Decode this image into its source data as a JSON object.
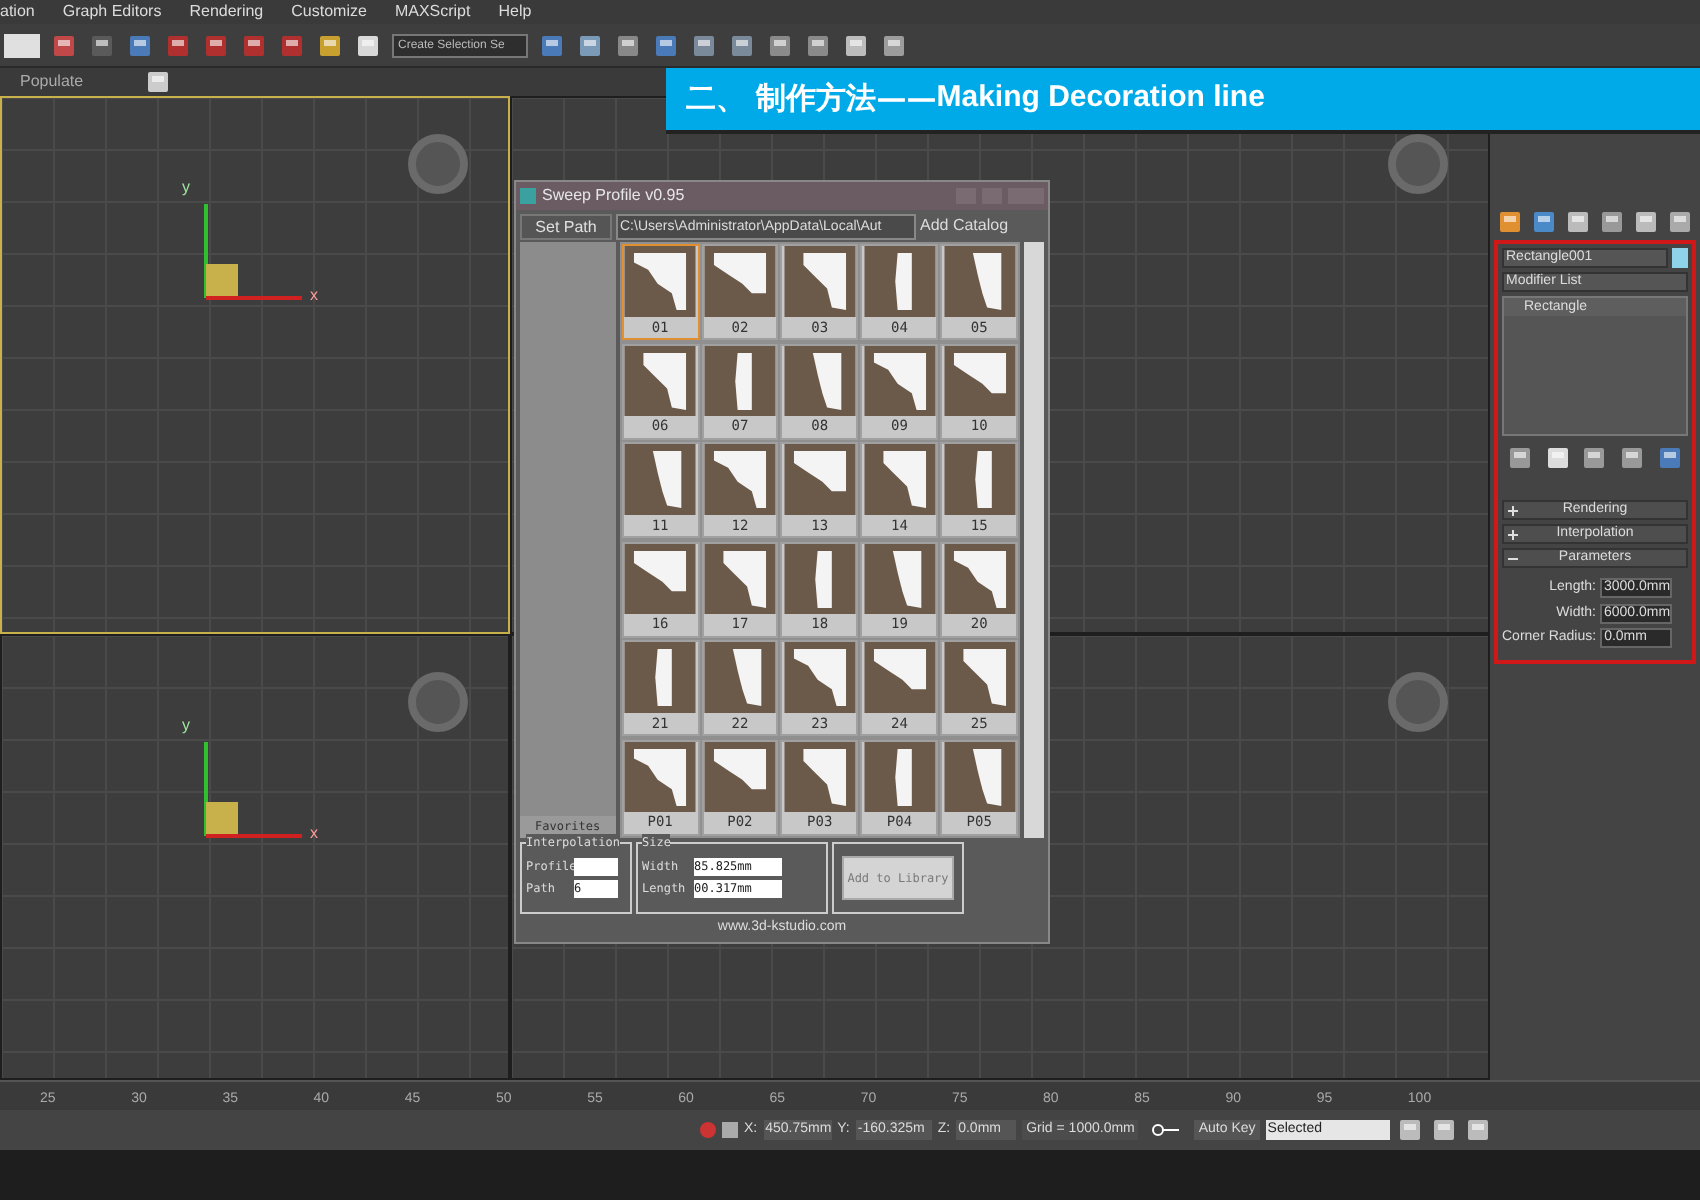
{
  "menu": [
    "ation",
    "Graph Editors",
    "Rendering",
    "Customize",
    "MAXScript",
    "Help"
  ],
  "toolbar": {
    "selection_set": "Create Selection Se"
  },
  "ribbon": {
    "tab": "Populate"
  },
  "banner": {
    "chinese": "二、 制作方法——",
    "english": "Making Decoration line"
  },
  "viewports": [
    {
      "active": true,
      "axis_labels": [
        "y",
        "x"
      ]
    },
    {
      "active": false
    },
    {
      "active": false,
      "axis_labels": [
        "y",
        "x"
      ]
    },
    {
      "active": false
    }
  ],
  "dialog": {
    "title": "Sweep Profile v0.95",
    "set_path": "Set Path",
    "path": "C:\\Users\\Administrator\\AppData\\Local\\Aut",
    "add_catalog": "Add Catalog",
    "favorites": "Favorites",
    "profiles": [
      {
        "label": "01",
        "selected": true
      },
      {
        "label": "02",
        "selected": false
      },
      {
        "label": "03",
        "selected": false
      },
      {
        "label": "04",
        "selected": false
      },
      {
        "label": "05",
        "selected": false
      },
      {
        "label": "06",
        "selected": false
      },
      {
        "label": "07",
        "selected": false
      },
      {
        "label": "08",
        "selected": false
      },
      {
        "label": "09",
        "selected": false
      },
      {
        "label": "10",
        "selected": false
      },
      {
        "label": "11",
        "selected": false
      },
      {
        "label": "12",
        "selected": false
      },
      {
        "label": "13",
        "selected": false
      },
      {
        "label": "14",
        "selected": false
      },
      {
        "label": "15",
        "selected": false
      },
      {
        "label": "16",
        "selected": false
      },
      {
        "label": "17",
        "selected": false
      },
      {
        "label": "18",
        "selected": false
      },
      {
        "label": "19",
        "selected": false
      },
      {
        "label": "20",
        "selected": false
      },
      {
        "label": "21",
        "selected": false
      },
      {
        "label": "22",
        "selected": false
      },
      {
        "label": "23",
        "selected": false
      },
      {
        "label": "24",
        "selected": false
      },
      {
        "label": "25",
        "selected": false
      },
      {
        "label": "P01",
        "selected": false
      },
      {
        "label": "P02",
        "selected": false
      },
      {
        "label": "P03",
        "selected": false
      },
      {
        "label": "P04",
        "selected": false
      },
      {
        "label": "P05",
        "selected": false
      }
    ],
    "interpolation": {
      "title": "Interpolation",
      "profile_label": "Profile",
      "path_label": "Path",
      "path_value": "6"
    },
    "size": {
      "title": "Size",
      "width_label": "Width",
      "width_value": "85.825mm",
      "length_label": "Length",
      "length_value": "00.317mm"
    },
    "add_button": {
      "label": "Add to Library",
      "disabled": true
    },
    "footer": "www.3d-kstudio.com"
  },
  "command_panel": {
    "object_name": "Rectangle001",
    "modifier_list": "Modifier List",
    "stack": [
      "Rectangle"
    ],
    "rollouts": [
      {
        "label": "Rendering",
        "expanded": false
      },
      {
        "label": "Interpolation",
        "expanded": false
      },
      {
        "label": "Parameters",
        "expanded": true
      }
    ],
    "parameters": [
      {
        "label": "Length:",
        "value": "3000.0mm"
      },
      {
        "label": "Width:",
        "value": "6000.0mm"
      },
      {
        "label": "Corner Radius:",
        "value": "0.0mm"
      }
    ]
  },
  "timeline": {
    "ticks": [
      "25",
      "30",
      "35",
      "40",
      "45",
      "50",
      "55",
      "60",
      "65",
      "70",
      "75",
      "80",
      "85",
      "90",
      "95",
      "100"
    ]
  },
  "status": {
    "x_label": "X:",
    "x": "450.75mm",
    "y_label": "Y:",
    "y": "-160.325m",
    "z_label": "Z:",
    "z": "0.0mm",
    "grid": "Grid = 1000.0mm",
    "auto_key": "Auto Key",
    "key_filter": "Selected"
  }
}
